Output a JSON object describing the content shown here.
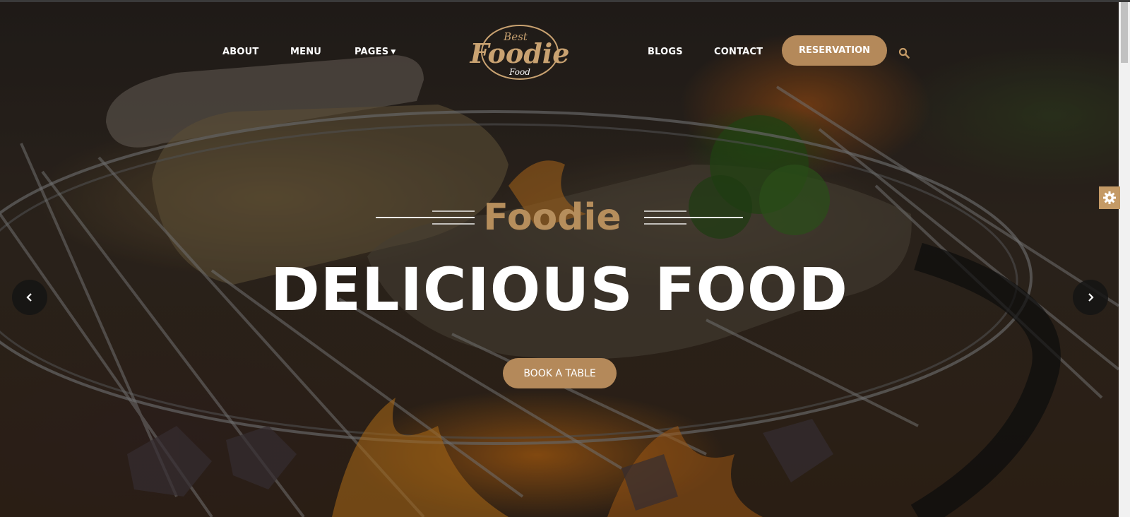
{
  "nav": {
    "links": [
      "ABOUT",
      "MENU",
      "PAGES",
      "BLOGS",
      "CONTACT"
    ],
    "reservation_label": "RESERVATION",
    "search_icon": "search-icon",
    "pages_dropdown_icon": "chevron-down-icon"
  },
  "logo": {
    "top": "Best",
    "main": "Foodie",
    "bottom": "Food"
  },
  "hero": {
    "subtitle": "Foodie",
    "headline": "DELICIOUS FOOD",
    "cta_label": "BOOK A TABLE",
    "prev_icon": "chevron-left-icon",
    "next_icon": "chevron-right-icon"
  },
  "settings": {
    "icon": "gear-icon"
  },
  "colors": {
    "accent": "#b4895a",
    "subtitle": "#b68e5c",
    "text": "#ffffff"
  }
}
